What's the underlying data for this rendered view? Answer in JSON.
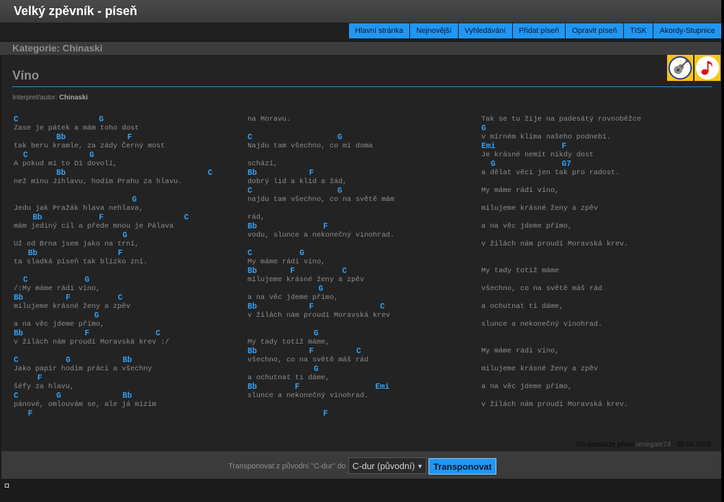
{
  "site_title": "Velký zpěvník - píseň",
  "nav": [
    "Hlavní stránka",
    "Nejnovější",
    "Vyhledávání",
    "Přidat píseň",
    "Opravit píseň",
    "TISK",
    "Akordy-Stupnice"
  ],
  "category": "Kategorie: Chinaski",
  "song": {
    "title": "Víno",
    "author_label": "Interpret/autor:",
    "author": "Chinaski"
  },
  "columns": [
    [
      {
        "t": "c",
        "s": "C                 G"
      },
      {
        "t": "l",
        "s": "Zase je pátek a mám toho dost"
      },
      {
        "t": "c",
        "s": "         Bb             F"
      },
      {
        "t": "l",
        "s": "tak beru kramle, za zády Černý most"
      },
      {
        "t": "c",
        "s": "  C             G"
      },
      {
        "t": "l",
        "s": "A pokud mi to D1 dovolí,"
      },
      {
        "t": "c",
        "s": "         Bb                              C"
      },
      {
        "t": "l",
        "s": "než minu Jihlavu, hodím Prahu za hlavu."
      },
      {
        "t": "l",
        "s": ""
      },
      {
        "t": "c",
        "s": "                         G"
      },
      {
        "t": "l",
        "s": "Jedu jak Pražák hlava nehlava,"
      },
      {
        "t": "c",
        "s": "    Bb            F                 C"
      },
      {
        "t": "l",
        "s": "mám jediný cíl a přede mnou je Pálava"
      },
      {
        "t": "c",
        "s": "                       G"
      },
      {
        "t": "l",
        "s": "Už od Brna jsem jako na trní,"
      },
      {
        "t": "c",
        "s": "   Bb                 F"
      },
      {
        "t": "l",
        "s": "ta sladká píseň tak blízko zní."
      },
      {
        "t": "l",
        "s": ""
      },
      {
        "t": "c",
        "s": "  C            G"
      },
      {
        "t": "l",
        "s": "/:My máme rádi víno,"
      },
      {
        "t": "c",
        "s": "Bb         F          C"
      },
      {
        "t": "l",
        "s": "milujeme krásné ženy a zpěv"
      },
      {
        "t": "c",
        "s": "                 G"
      },
      {
        "t": "l",
        "s": "a na věc jdeme přímo,"
      },
      {
        "t": "c",
        "s": "Bb             F              C"
      },
      {
        "t": "l",
        "s": "v žilách nám proudí Moravská krev :/"
      },
      {
        "t": "l",
        "s": ""
      },
      {
        "t": "c",
        "s": "C          G           Bb"
      },
      {
        "t": "l",
        "s": "Jako papír hodím práci a všechny"
      },
      {
        "t": "c",
        "s": "     F"
      },
      {
        "t": "l",
        "s": "šéfy za hlavu,"
      },
      {
        "t": "c",
        "s": "C        G             Bb"
      },
      {
        "t": "l",
        "s": "pánové, omlouvám se, ale já mizím"
      },
      {
        "t": "c",
        "s": "   F"
      }
    ],
    [
      {
        "t": "l",
        "s": "na Moravu."
      },
      {
        "t": "l",
        "s": ""
      },
      {
        "t": "c",
        "s": "C                  G"
      },
      {
        "t": "l",
        "s": "Najdu tam všechno, co mi doma"
      },
      {
        "t": "l",
        "s": ""
      },
      {
        "t": "l",
        "s": "schází,"
      },
      {
        "t": "c",
        "s": "Bb           F"
      },
      {
        "t": "l",
        "s": "dobrý lid a klid a žád,"
      },
      {
        "t": "c",
        "s": "C                  G"
      },
      {
        "t": "l",
        "s": "najdu tam všechno, co na světě mám"
      },
      {
        "t": "l",
        "s": ""
      },
      {
        "t": "l",
        "s": "rád,"
      },
      {
        "t": "c",
        "s": "Bb              F"
      },
      {
        "t": "l",
        "s": "vodu, slunce a nekonečný vinohrad."
      },
      {
        "t": "l",
        "s": ""
      },
      {
        "t": "c",
        "s": "C          G"
      },
      {
        "t": "l",
        "s": "My máme rádi víno,"
      },
      {
        "t": "c",
        "s": "Bb       F          C"
      },
      {
        "t": "l",
        "s": "milujeme krásné ženy a zpěv"
      },
      {
        "t": "c",
        "s": "               G"
      },
      {
        "t": "l",
        "s": "a na věc jdeme přímo,"
      },
      {
        "t": "c",
        "s": "Bb           F              C"
      },
      {
        "t": "l",
        "s": "v žilách nám proudí Moravská krev"
      },
      {
        "t": "l",
        "s": ""
      },
      {
        "t": "c",
        "s": "              G"
      },
      {
        "t": "l",
        "s": "My tady totiž máme,"
      },
      {
        "t": "c",
        "s": "Bb           F         C"
      },
      {
        "t": "l",
        "s": "všechno, co na světě máš rád"
      },
      {
        "t": "c",
        "s": "              G"
      },
      {
        "t": "l",
        "s": "a ochutnat ti dáme,"
      },
      {
        "t": "c",
        "s": "Bb        F                Emi"
      },
      {
        "t": "l",
        "s": "slunce a nekonečný vinohrad."
      },
      {
        "t": "l",
        "s": ""
      },
      {
        "t": "c",
        "s": "                F"
      }
    ],
    [
      {
        "t": "l",
        "s": "Tak se tu žije na padesátý rovnoběžce"
      },
      {
        "t": "c",
        "s": "G"
      },
      {
        "t": "l",
        "s": "v mírném klima našeho podnebí."
      },
      {
        "t": "c",
        "s": "Emi              F"
      },
      {
        "t": "l",
        "s": "Je krásné nemít nikdy dost"
      },
      {
        "t": "c",
        "s": "  G              G7"
      },
      {
        "t": "l",
        "s": "a dělat věci jen tak pro radost."
      },
      {
        "t": "l",
        "s": ""
      },
      {
        "t": "l",
        "s": "My máme rádi víno,"
      },
      {
        "t": "l",
        "s": ""
      },
      {
        "t": "l",
        "s": "milujeme krásné ženy a zpěv"
      },
      {
        "t": "l",
        "s": ""
      },
      {
        "t": "l",
        "s": "a na věc jdeme přímo,"
      },
      {
        "t": "l",
        "s": ""
      },
      {
        "t": "l",
        "s": "v žilách nám proudí Moravská krev."
      },
      {
        "t": "l",
        "s": ""
      },
      {
        "t": "l",
        "s": ""
      },
      {
        "t": "l",
        "s": "My tady totiž máme"
      },
      {
        "t": "l",
        "s": ""
      },
      {
        "t": "l",
        "s": "všechno, co na světě máš rád"
      },
      {
        "t": "l",
        "s": ""
      },
      {
        "t": "l",
        "s": "a ochutnat ti dáme,"
      },
      {
        "t": "l",
        "s": ""
      },
      {
        "t": "l",
        "s": "slunce a nekonečný vinohrad."
      },
      {
        "t": "l",
        "s": ""
      },
      {
        "t": "l",
        "s": ""
      },
      {
        "t": "l",
        "s": "My máme rádi víno,"
      },
      {
        "t": "l",
        "s": ""
      },
      {
        "t": "l",
        "s": "milujeme krásné ženy a zpěv"
      },
      {
        "t": "l",
        "s": ""
      },
      {
        "t": "l",
        "s": "a na věc jdeme přímo,"
      },
      {
        "t": "l",
        "s": ""
      },
      {
        "t": "l",
        "s": "v žilách nám proudí Moravská krev."
      }
    ]
  ],
  "footer": {
    "added_prefix": "Do databáze přidal",
    "user": "renegate74",
    "date_sep": " - 05.04.2015."
  },
  "transpose": {
    "label": "Transponovat z původní \"C-dur\" do",
    "selected": "C-dur (původní)",
    "button": "Transponovat"
  },
  "icons": [
    "guitar-icon",
    "music-note-icon"
  ],
  "colors": {
    "accent": "#2196f3",
    "chord": "#33a0f5",
    "background": "#232323"
  }
}
